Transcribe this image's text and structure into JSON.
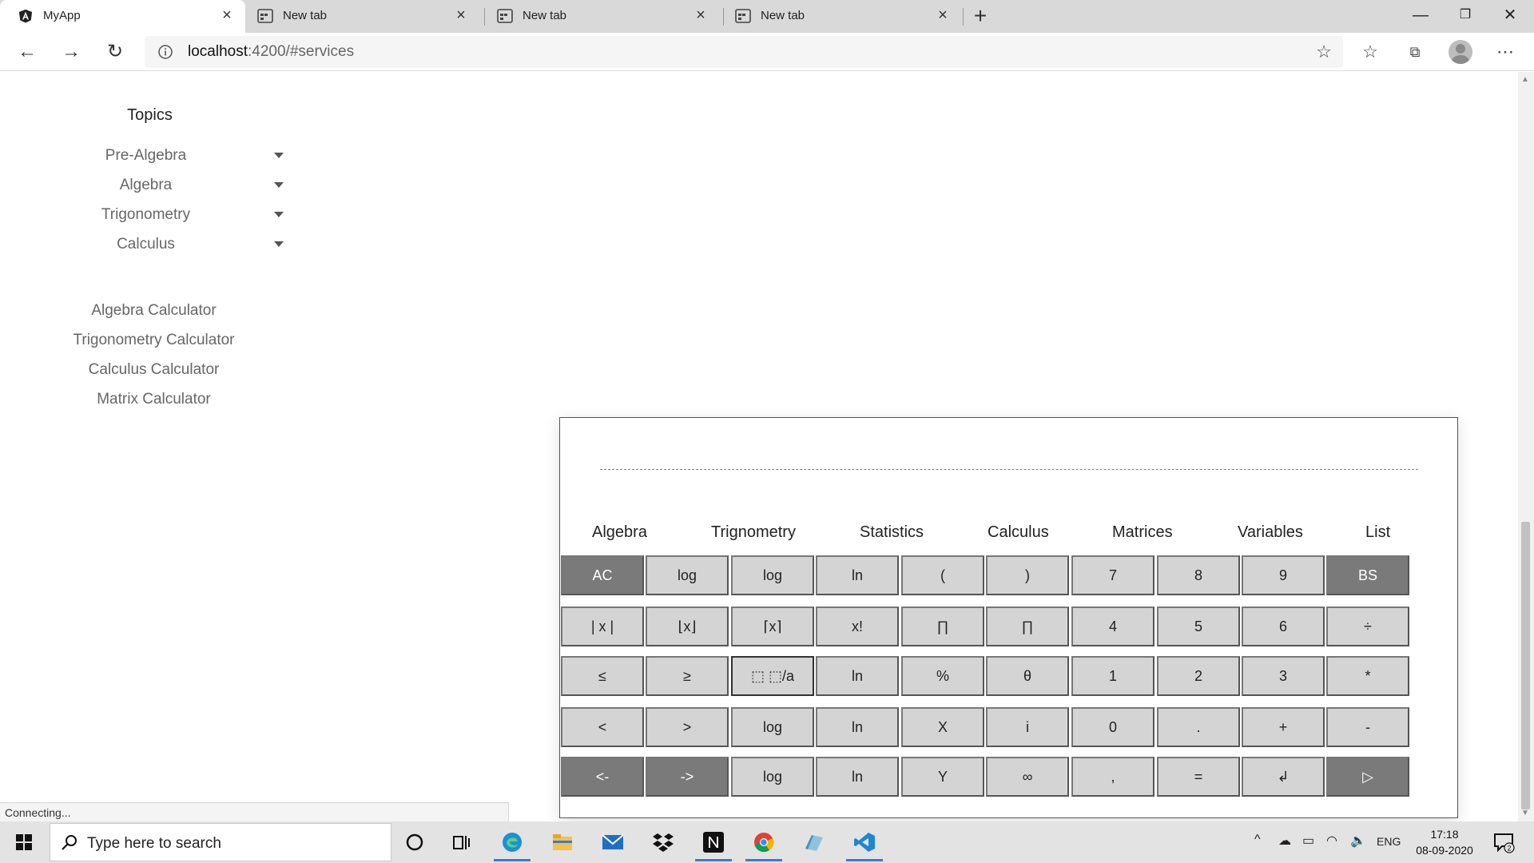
{
  "browser": {
    "tabs": [
      {
        "title": "MyApp",
        "active": true,
        "icon": "angular-icon"
      },
      {
        "title": "New tab",
        "active": false,
        "icon": "newtab-icon"
      },
      {
        "title": "New tab",
        "active": false,
        "icon": "newtab-icon"
      },
      {
        "title": "New tab",
        "active": false,
        "icon": "newtab-icon"
      }
    ],
    "url_host": "localhost",
    "url_path": ":4200/#services"
  },
  "sidebar": {
    "topics_title": "Topics",
    "topics": [
      "Pre-Algebra",
      "Algebra",
      "Trigonometry",
      "Calculus"
    ],
    "calculators": [
      "Algebra Calculator",
      "Trigonometry Calculator",
      "Calculus Calculator",
      "Matrix Calculator"
    ]
  },
  "calculator": {
    "categories": [
      "Algebra",
      "Trignometry",
      "Statistics",
      "Calculus",
      "Matrices",
      "Variables",
      "List"
    ],
    "keys": [
      [
        "AC",
        "log",
        "log",
        "ln",
        "(",
        ")",
        "7",
        "8",
        "9",
        "BS"
      ],
      [
        "| x |",
        "⌊x⌋",
        "⌈x⌉",
        "x!",
        "∏",
        "∏",
        "4",
        "5",
        "6",
        "÷"
      ],
      [
        "≤",
        "≥",
        "⬚ ⬚/a",
        "ln",
        "%",
        "θ",
        "1",
        "2",
        "3",
        "*"
      ],
      [
        "<",
        ">",
        "log",
        "ln",
        "X",
        "i",
        "0",
        ".",
        "+",
        "-"
      ],
      [
        "<-",
        "->",
        "log",
        "ln",
        "Y",
        "∞",
        ",",
        "=",
        "↲",
        "▷"
      ]
    ]
  },
  "status": {
    "text": "Connecting..."
  },
  "taskbar": {
    "search_placeholder": "Type here to search",
    "language": "ENG",
    "time": "17:18",
    "date": "08-09-2020",
    "notification_count": "2"
  },
  "colors": {
    "key_dark": "#7a7a7a",
    "key_light": "#d4d4d4",
    "display_line": "#e05555"
  }
}
